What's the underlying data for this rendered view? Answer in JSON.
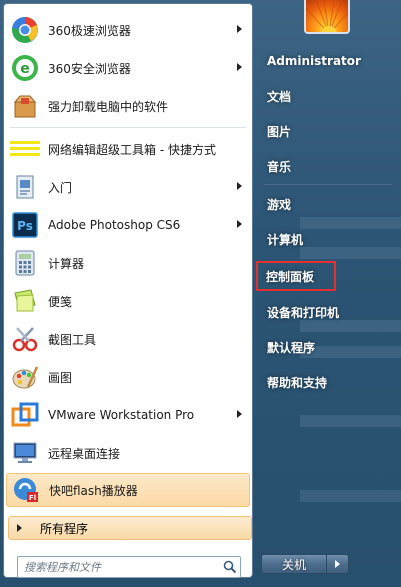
{
  "programs": [
    {
      "label": "360极速浏览器",
      "icon": "chrome-360-icon",
      "has_arrow": true
    },
    {
      "label": "360安全浏览器",
      "icon": "ie-360-icon",
      "has_arrow": true
    },
    {
      "label": "强力卸载电脑中的软件",
      "icon": "uninstall-box-icon",
      "has_arrow": false
    },
    {
      "label": "网络编辑超级工具箱 - 快捷方式",
      "icon": "yellow-lines-icon",
      "has_arrow": false
    },
    {
      "label": "入门",
      "icon": "getting-started-icon",
      "has_arrow": true
    },
    {
      "label": "Adobe Photoshop CS6",
      "icon": "photoshop-icon",
      "has_arrow": true
    },
    {
      "label": "计算器",
      "icon": "calculator-icon",
      "has_arrow": false
    },
    {
      "label": "便笺",
      "icon": "sticky-notes-icon",
      "has_arrow": false
    },
    {
      "label": "截图工具",
      "icon": "snipping-tool-icon",
      "has_arrow": false
    },
    {
      "label": "画图",
      "icon": "paint-icon",
      "has_arrow": false
    },
    {
      "label": "VMware Workstation Pro",
      "icon": "vmware-icon",
      "has_arrow": true
    },
    {
      "label": "远程桌面连接",
      "icon": "remote-desktop-icon",
      "has_arrow": false
    },
    {
      "label": "快吧flash播放器",
      "icon": "flash-player-icon",
      "has_arrow": false
    }
  ],
  "all_programs_label": "所有程序",
  "search": {
    "placeholder": "搜索程序和文件"
  },
  "right_menu": [
    {
      "label": "Administrator"
    },
    {
      "label": "文档"
    },
    {
      "label": "图片"
    },
    {
      "label": "音乐"
    },
    {
      "label": "游戏"
    },
    {
      "label": "计算机"
    },
    {
      "label": "控制面板"
    },
    {
      "label": "设备和打印机"
    },
    {
      "label": "默认程序"
    },
    {
      "label": "帮助和支持"
    }
  ],
  "shutdown_label": "关机",
  "colors": {
    "highlight_border": "#e53030",
    "pinned_highlight": "#fbd9a5"
  }
}
